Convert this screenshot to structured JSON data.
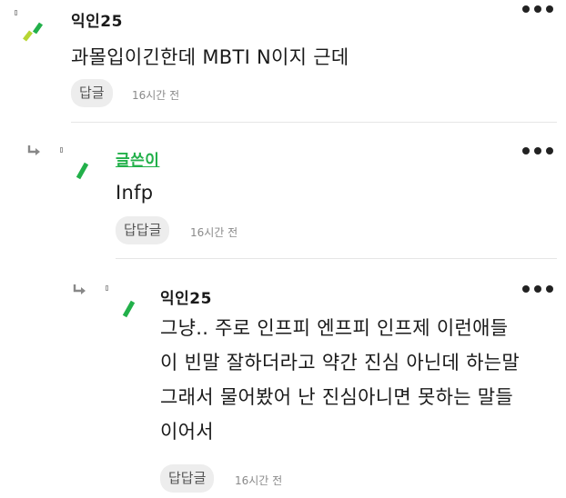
{
  "icons": {
    "reply_arrow": "reply-arrow-icon",
    "more": "more-options-icon"
  },
  "colors": {
    "op_name": "#22b04a",
    "avatar_green": "#22b04a",
    "avatar_lime": "#b7d633"
  },
  "comments": [
    {
      "author": "익인25",
      "text": "과몰입이긴한데 MBTI N이지 근데",
      "reply_label": "답글",
      "time": "16시간 전"
    },
    {
      "author": "글쓴이",
      "text": "Infp",
      "reply_label": "답답글",
      "time": "16시간 전"
    },
    {
      "author": "익인25",
      "text": "그냥.. 주로 인프피 엔프피 인프제 이런애들\n이 빈말 잘하더라고 약간 진심 아닌데 하는말\n그래서 물어봤어 난 진심아니면 못하는 말들\n이어서",
      "reply_label": "답답글",
      "time": "16시간 전"
    }
  ]
}
